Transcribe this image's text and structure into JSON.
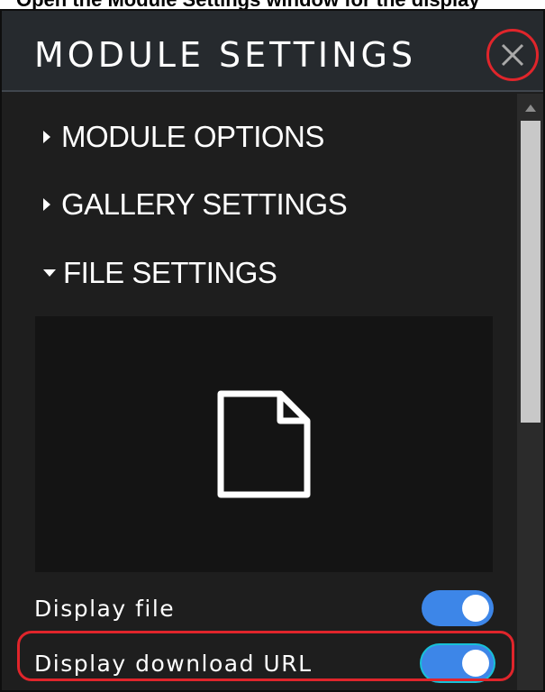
{
  "top_strip": {
    "text": "Open the Module Settings window for the display"
  },
  "header": {
    "title": "MODULE SETTINGS",
    "close_icon": "close-x-icon"
  },
  "sections": [
    {
      "label": "MODULE OPTIONS",
      "expanded": false
    },
    {
      "label": "GALLERY SETTINGS",
      "expanded": false
    },
    {
      "label": "FILE SETTINGS",
      "expanded": true
    }
  ],
  "preview": {
    "icon": "document-icon"
  },
  "toggles": [
    {
      "label": "Display file",
      "on": true
    },
    {
      "label": "Display download URL",
      "on": true,
      "highlighted": true
    }
  ],
  "colors": {
    "accent": "#3d86e8",
    "highlight": "#e0252b",
    "panel_bg": "#1e1e1e",
    "header_bg": "#262a2e"
  }
}
